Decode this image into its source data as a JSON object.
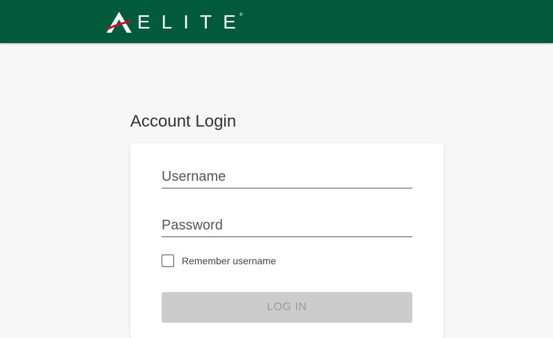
{
  "header": {
    "logo_text": "ELITE",
    "logo_reg": "®",
    "logo_icon": "elite-a-mark-icon",
    "background_color": "#015a3b",
    "accent_color": "#c8102e"
  },
  "login": {
    "title": "Account Login",
    "username_placeholder": "Username",
    "username_value": "",
    "password_placeholder": "Password",
    "password_value": "",
    "remember_label": "Remember username",
    "remember_checked": false,
    "button_label": "LOG IN"
  }
}
